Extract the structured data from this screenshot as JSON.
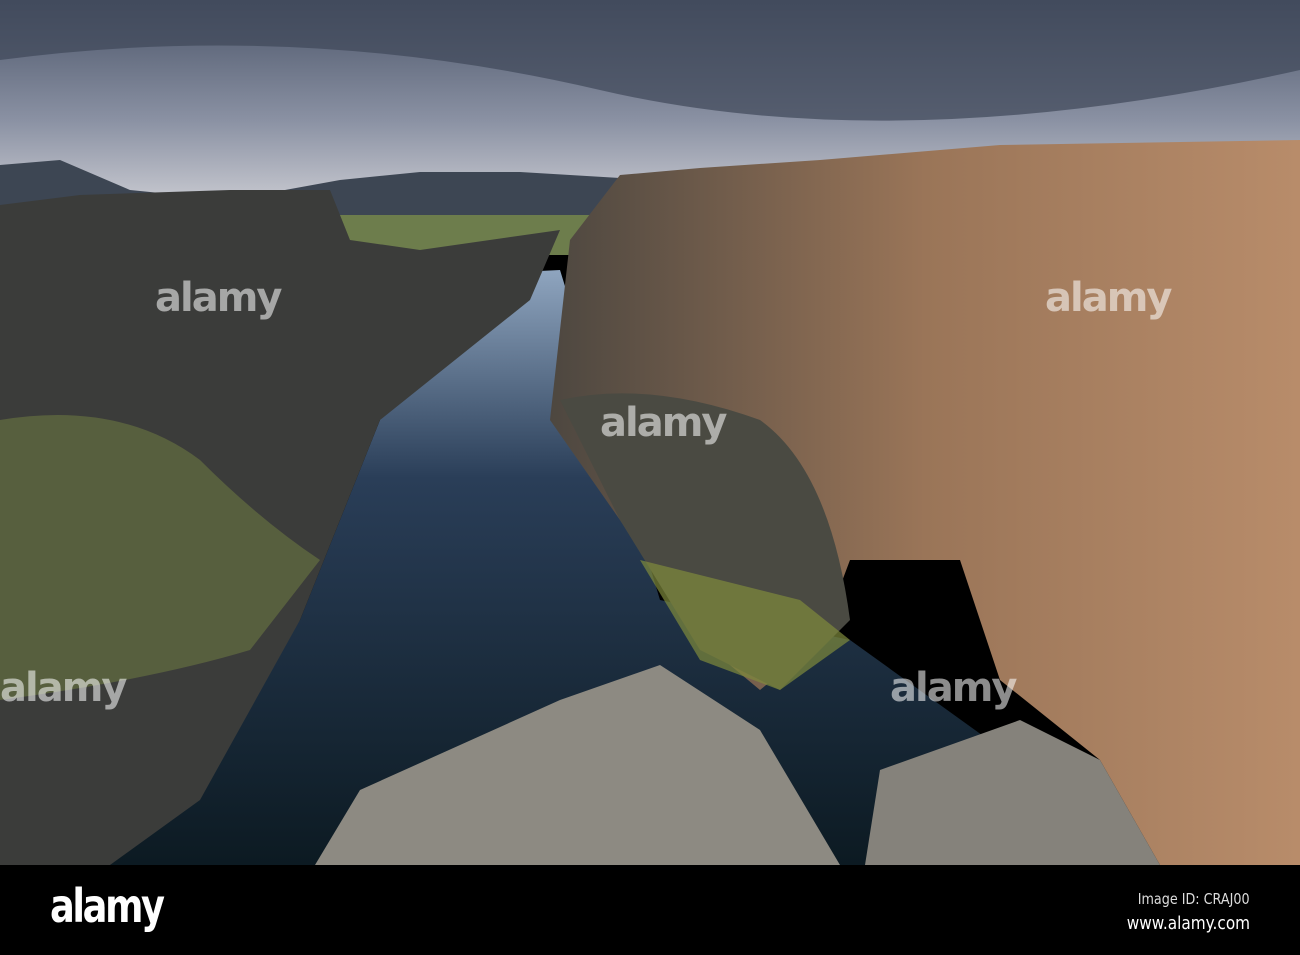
{
  "photo": {
    "subject": "lava rock fissure with clear water under cloudy sky"
  },
  "watermark": {
    "text": "alamy"
  },
  "footer": {
    "logo": "alamy",
    "image_id": "Image ID: CRAJ00",
    "url": "www.alamy.com"
  }
}
